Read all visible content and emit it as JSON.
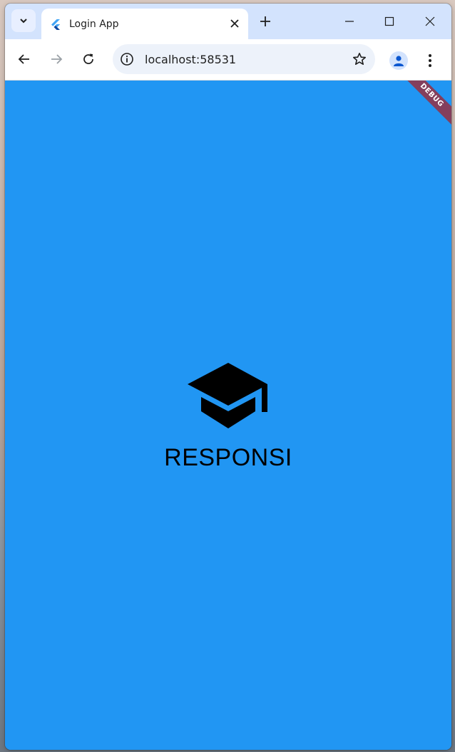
{
  "browser": {
    "tab": {
      "title": "Login App"
    },
    "address_bar": {
      "url": "localhost:58531"
    }
  },
  "app": {
    "title": "RESPONSI",
    "debug_banner": "DEBUG",
    "background_color": "#2196f3",
    "logo_icon": "graduation-cap-icon"
  }
}
